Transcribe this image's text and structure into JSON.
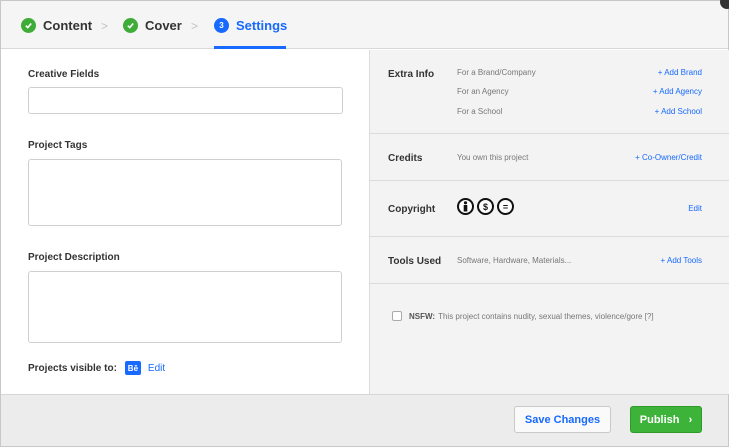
{
  "steps": [
    {
      "label": "Content",
      "state": "done"
    },
    {
      "label": "Cover",
      "state": "done"
    },
    {
      "label": "Settings",
      "state": "active",
      "number": "3"
    }
  ],
  "step_separator": ">",
  "left": {
    "creative_fields_label": "Creative Fields",
    "project_tags_label": "Project Tags",
    "project_description_label": "Project Description",
    "visible_to_label": "Projects visible to:",
    "visible_badge": "Bē",
    "visible_edit": "Edit"
  },
  "right": {
    "extra_info": {
      "label": "Extra Info",
      "rows": [
        {
          "text": "For a Brand/Company",
          "link": "+ Add Brand"
        },
        {
          "text": "For an Agency",
          "link": "+ Add Agency"
        },
        {
          "text": "For a School",
          "link": "+ Add School"
        }
      ]
    },
    "credits": {
      "label": "Credits",
      "text": "You own this project",
      "link": "+ Co-Owner/Credit"
    },
    "copyright": {
      "label": "Copyright",
      "icons": [
        "cc-by-icon",
        "cc-nc-icon",
        "cc-nd-icon"
      ],
      "link": "Edit"
    },
    "tools": {
      "label": "Tools Used",
      "text": "Software, Hardware, Materials...",
      "link": "+ Add Tools"
    },
    "nsfw": {
      "strong": "NSFW:",
      "text": "This project contains nudity, sexual themes, violence/gore [?]"
    }
  },
  "footer": {
    "save_label": "Save Changes",
    "publish_label": "Publish",
    "publish_arrow": "›"
  },
  "colors": {
    "accent": "#1769ff",
    "success": "#3eb33a"
  }
}
